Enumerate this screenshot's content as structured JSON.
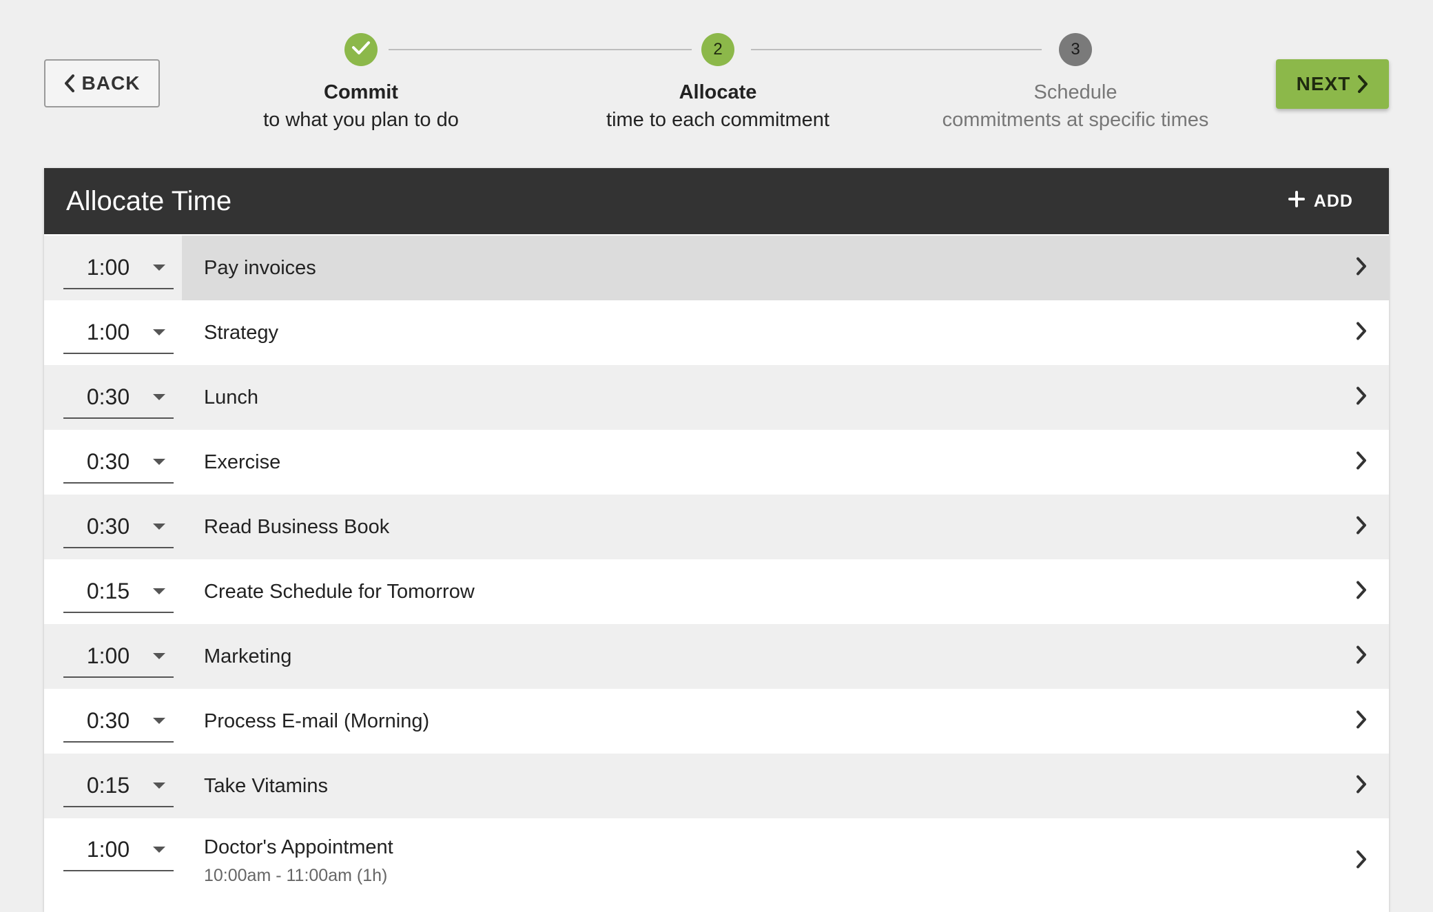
{
  "nav": {
    "back_label": "BACK",
    "next_label": "NEXT"
  },
  "steps": [
    {
      "number": "",
      "title": "Commit",
      "subtitle": "to what you plan to do",
      "state": "done"
    },
    {
      "number": "2",
      "title": "Allocate",
      "subtitle": "time to each commitment",
      "state": "active"
    },
    {
      "number": "3",
      "title": "Schedule",
      "subtitle": "commitments at specific times",
      "state": "todo"
    }
  ],
  "colors": {
    "accent": "#8cb84a",
    "header_bg": "#333333",
    "todo_step": "#7a7a7a"
  },
  "panel": {
    "title": "Allocate Time",
    "add_label": "ADD"
  },
  "tasks": [
    {
      "time": "1:00",
      "name": "Pay invoices"
    },
    {
      "time": "1:00",
      "name": "Strategy"
    },
    {
      "time": "0:30",
      "name": "Lunch"
    },
    {
      "time": "0:30",
      "name": "Exercise"
    },
    {
      "time": "0:30",
      "name": "Read Business Book"
    },
    {
      "time": "0:15",
      "name": "Create Schedule for Tomorrow"
    },
    {
      "time": "1:00",
      "name": "Marketing"
    },
    {
      "time": "0:30",
      "name": "Process E-mail (Morning)"
    },
    {
      "time": "0:15",
      "name": "Take Vitamins"
    },
    {
      "time": "1:00",
      "name": "Doctor's Appointment",
      "detail": "10:00am - 11:00am (1h)"
    }
  ]
}
